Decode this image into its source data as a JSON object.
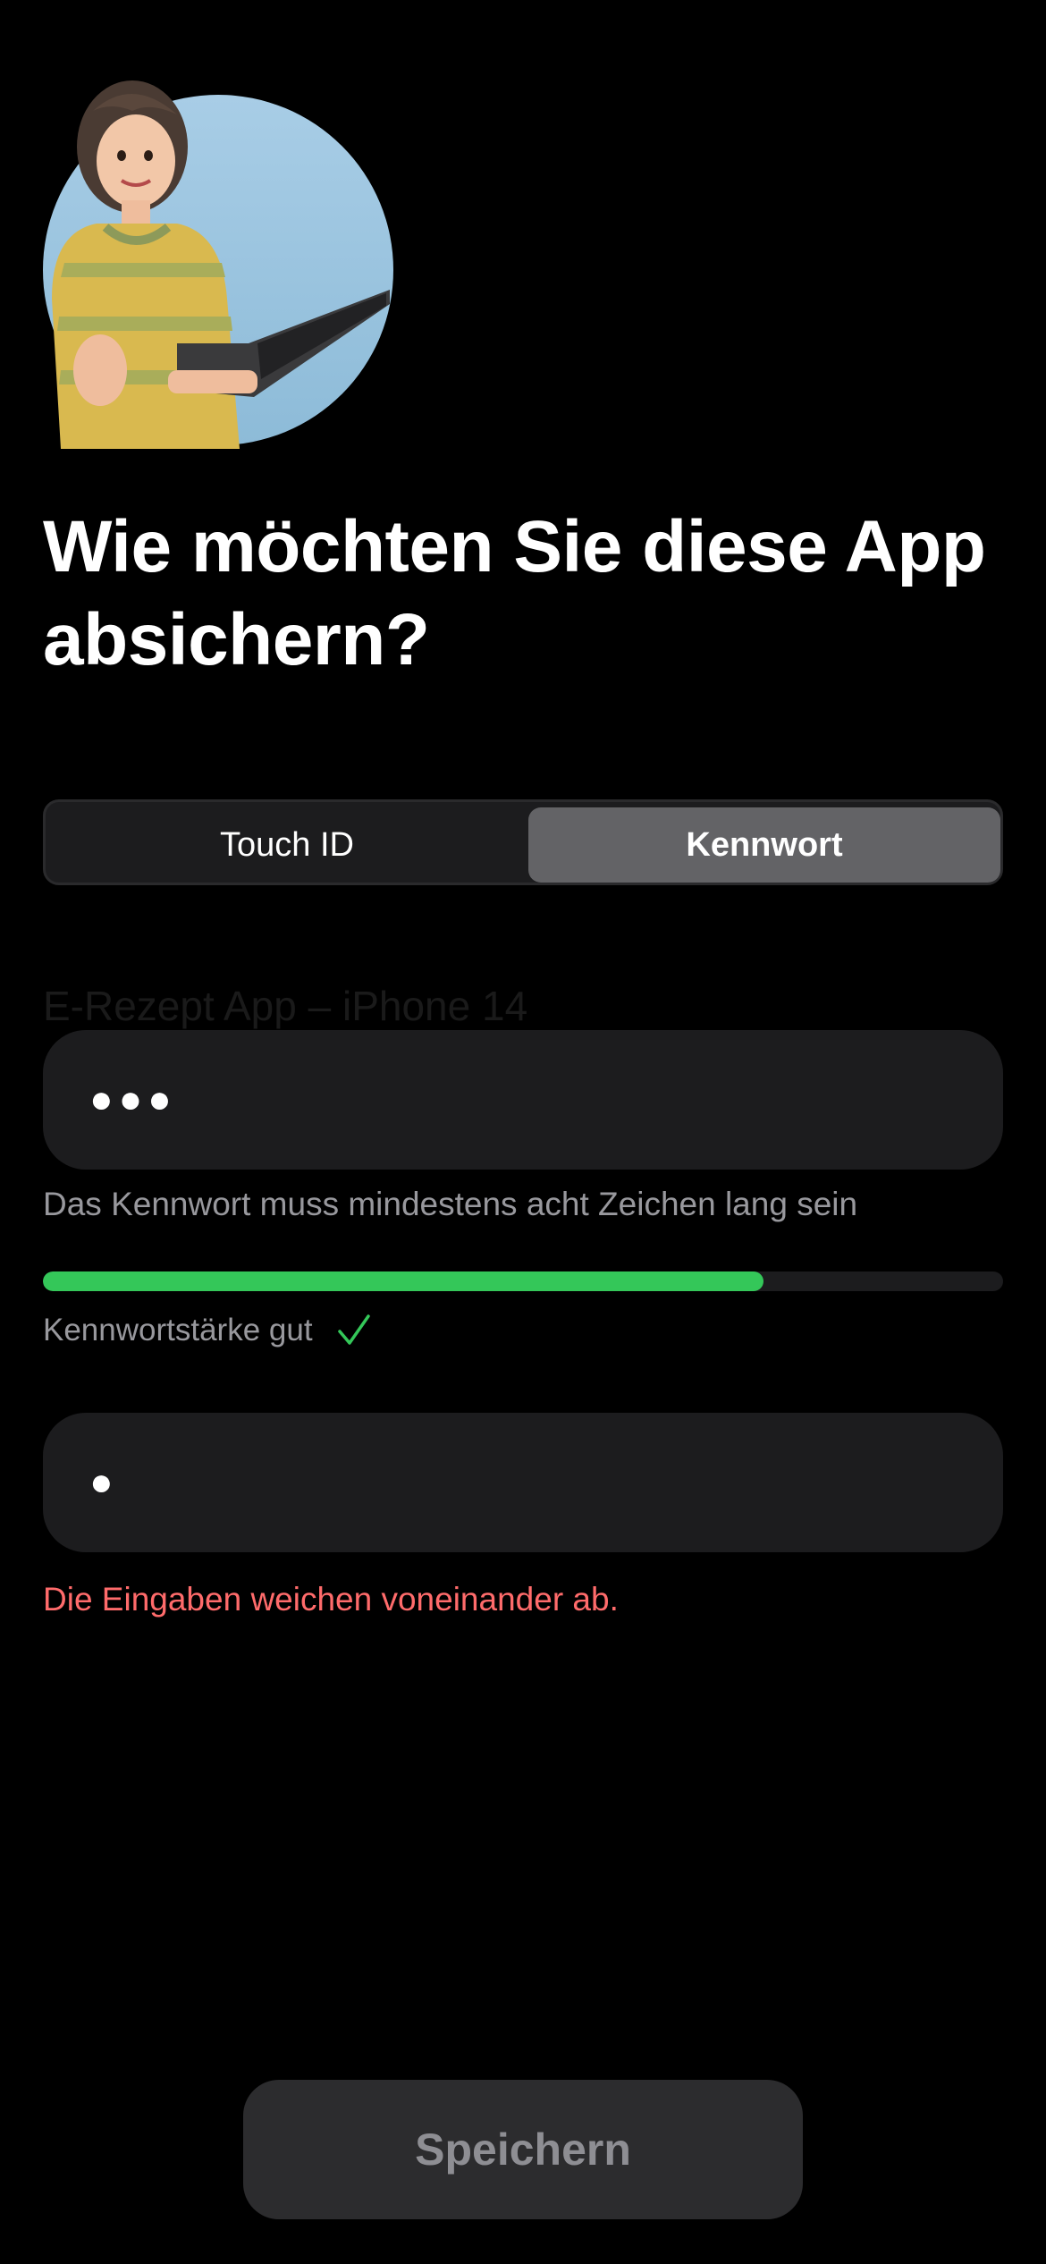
{
  "header": {
    "title": "Wie möchten Sie diese App absichern?"
  },
  "segmented": {
    "options": [
      "Touch ID",
      "Kennwort"
    ],
    "selected": "Kennwort"
  },
  "ghost_label": "E-Rezept App – iPhone 14",
  "password_field": {
    "masked_value": "●●●",
    "hint": "Das Kennwort muss mindestens acht Zeichen lang sein"
  },
  "strength": {
    "level": 0.75,
    "label": "Kennwortstärke gut",
    "color": "#34c759"
  },
  "confirm_field": {
    "masked_value": "●"
  },
  "error_text": "Die Eingaben weichen voneinander ab.",
  "save_button": {
    "label": "Speichern"
  },
  "colors": {
    "background": "#000000",
    "field": "#1c1c1e",
    "error": "#ff6b6b",
    "success": "#34c759"
  },
  "icons": {
    "strength_check": "checkmark-icon",
    "illustration": "woman-with-laptop-illustration"
  }
}
